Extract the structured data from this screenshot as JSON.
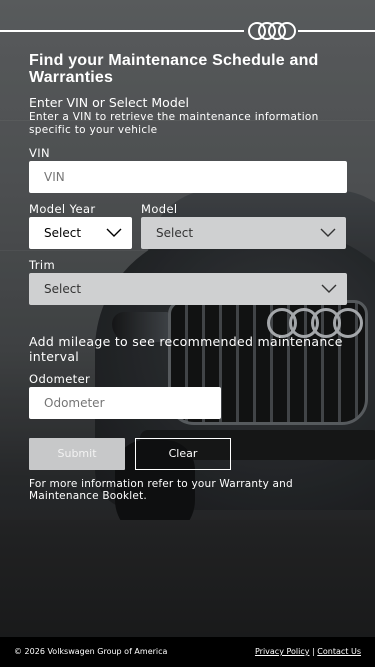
{
  "header": {
    "logo": "audi-rings-logo"
  },
  "page": {
    "title": "Find your Maintenance Schedule and Warranties",
    "subtitle": "Enter VIN or Select Model",
    "description": "Enter a VIN to retrieve the maintenance information specific to your vehicle"
  },
  "form": {
    "vin": {
      "label": "VIN",
      "placeholder": "VIN",
      "value": ""
    },
    "model_year": {
      "label": "Model Year",
      "selected": "Select"
    },
    "model": {
      "label": "Model",
      "selected": "Select"
    },
    "trim": {
      "label": "Trim",
      "selected": "Select"
    },
    "mileage_prompt": "Add mileage to see recommended maintenance interval",
    "odometer": {
      "label": "Odometer",
      "placeholder": "Odometer",
      "value": ""
    },
    "submit_label": "Submit",
    "clear_label": "Clear",
    "note": "For more information refer to your Warranty and Maintenance Booklet."
  },
  "footer": {
    "copyright": "© 2026 Volkswagen Group of America",
    "privacy_label": "Privacy Policy",
    "separator": "|",
    "contact_label": "Contact Us"
  },
  "colors": {
    "accent": "#ffffff",
    "disabled_button": "#c7c8c9",
    "disabled_select": "#cfd0d1",
    "footer_bg": "#000000"
  }
}
